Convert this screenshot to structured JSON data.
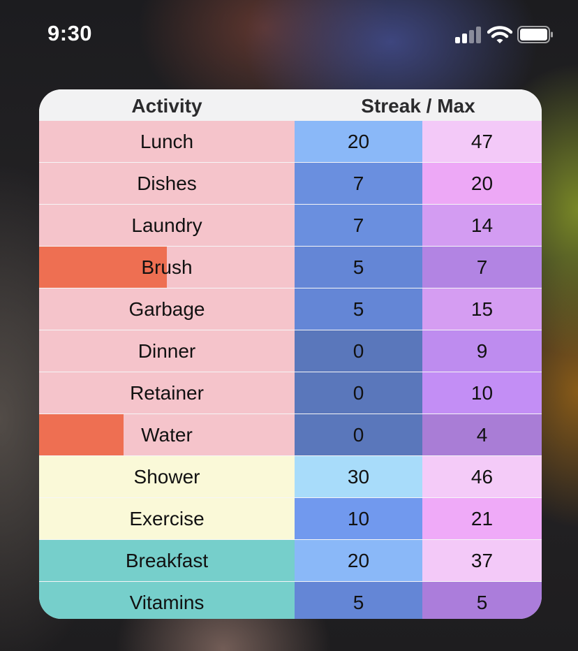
{
  "status_bar": {
    "time": "9:30",
    "signal_icon": "cellular-signal-icon",
    "wifi_icon": "wifi-icon",
    "battery_icon": "battery-icon"
  },
  "widget": {
    "headers": {
      "activity": "Activity",
      "streak_max": "Streak / Max"
    },
    "colors": {
      "group_pink": "#f5c4cb",
      "group_yellow": "#faf9d8",
      "group_teal": "#76cfcb",
      "progress_fill": "#ee6f52"
    },
    "rows": [
      {
        "activity": "Lunch",
        "streak": "20",
        "max": "47",
        "bg": "#f5c4cb",
        "progress": 0,
        "streak_color": "#8ab8f8",
        "max_color": "#f3c9f8"
      },
      {
        "activity": "Dishes",
        "streak": "7",
        "max": "20",
        "bg": "#f5c4cb",
        "progress": 0,
        "streak_color": "#6a8fdf",
        "max_color": "#eda8f6"
      },
      {
        "activity": "Laundry",
        "streak": "7",
        "max": "14",
        "bg": "#f5c4cb",
        "progress": 0,
        "streak_color": "#6a8fdf",
        "max_color": "#d39cf2"
      },
      {
        "activity": "Brush",
        "streak": "5",
        "max": "7",
        "bg": "#f5c4cb",
        "progress": 0.5,
        "streak_color": "#6486d6",
        "max_color": "#b284e3"
      },
      {
        "activity": "Garbage",
        "streak": "5",
        "max": "15",
        "bg": "#f5c4cb",
        "progress": 0,
        "streak_color": "#6486d6",
        "max_color": "#d59df2"
      },
      {
        "activity": "Dinner",
        "streak": "0",
        "max": "9",
        "bg": "#f5c4cb",
        "progress": 0,
        "streak_color": "#5a77bb",
        "max_color": "#be8cef"
      },
      {
        "activity": "Retainer",
        "streak": "0",
        "max": "10",
        "bg": "#f5c4cb",
        "progress": 0,
        "streak_color": "#5a77bb",
        "max_color": "#c38ef5"
      },
      {
        "activity": "Water",
        "streak": "0",
        "max": "4",
        "bg": "#f5c4cb",
        "progress": 0.33,
        "streak_color": "#5a77bb",
        "max_color": "#a97dd6"
      },
      {
        "activity": "Shower",
        "streak": "30",
        "max": "46",
        "bg": "#faf9d8",
        "progress": 0,
        "streak_color": "#a8dcfa",
        "max_color": "#f4cbf8"
      },
      {
        "activity": "Exercise",
        "streak": "10",
        "max": "21",
        "bg": "#faf9d8",
        "progress": 0,
        "streak_color": "#7199ee",
        "max_color": "#efaaf8"
      },
      {
        "activity": "Breakfast",
        "streak": "20",
        "max": "37",
        "bg": "#76cfcb",
        "progress": 0,
        "streak_color": "#8ab8f8",
        "max_color": "#f3c9f8"
      },
      {
        "activity": "Vitamins",
        "streak": "5",
        "max": "5",
        "bg": "#76cfcb",
        "progress": 0,
        "streak_color": "#6486d6",
        "max_color": "#ab7ddb"
      }
    ]
  }
}
